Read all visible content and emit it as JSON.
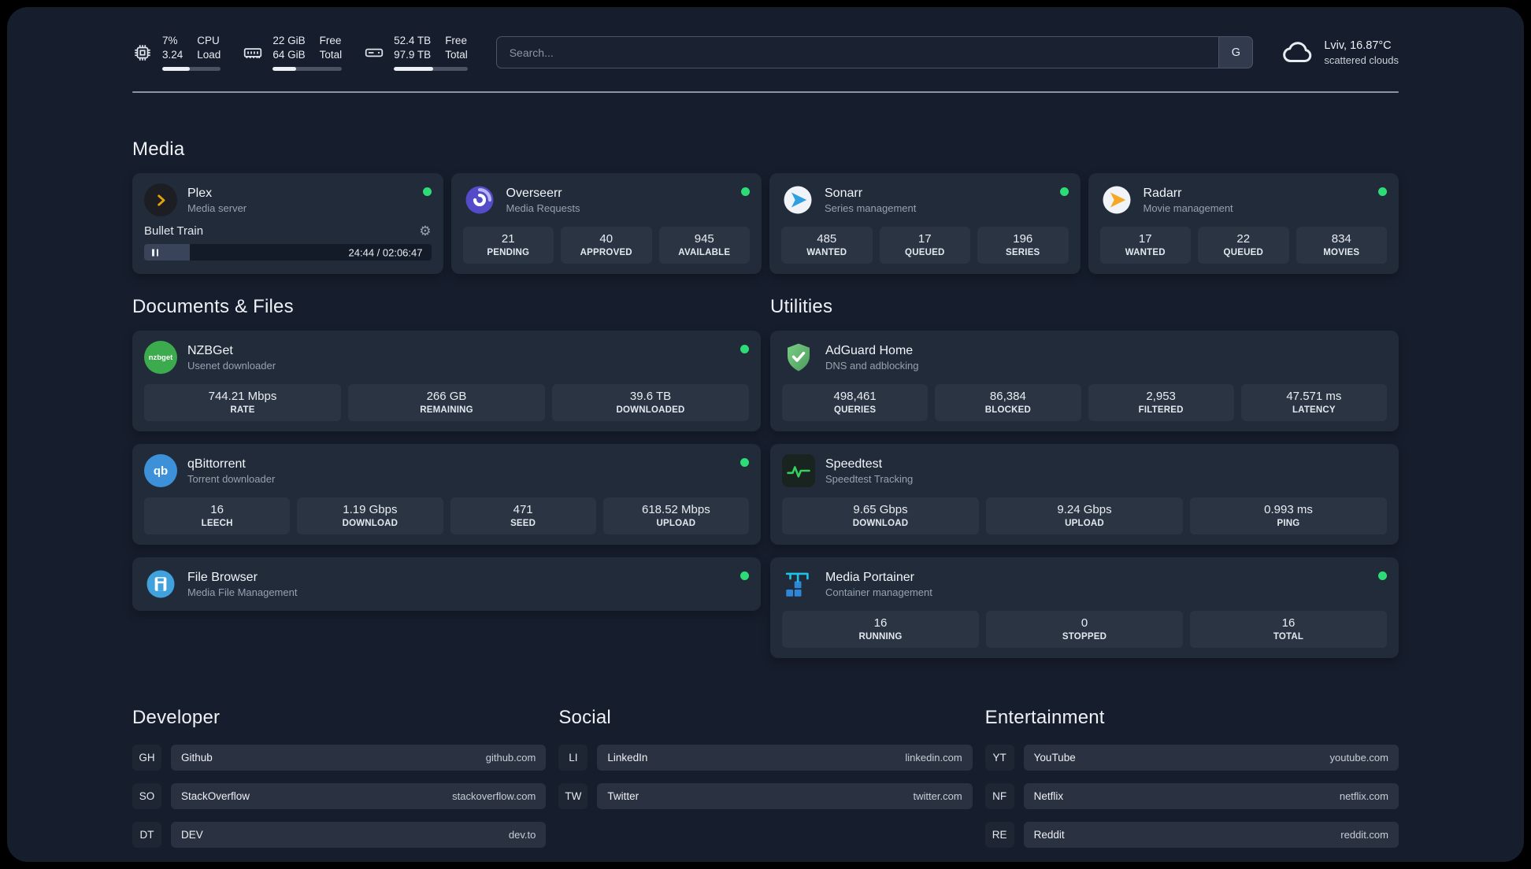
{
  "colors": {
    "status_online": "#2edc77",
    "plex_accent": "#e5a00d",
    "overseerr_accent": "#544bc9",
    "sonarr_accent": "#2f9fe0",
    "radarr_accent": "#f6a723",
    "nzbget_accent": "#3cab4d",
    "qbittorrent_accent": "#3d91d8",
    "filebrowser_accent": "#3fa2dd",
    "adguard_accent": "#68bc71",
    "speedtest_accent": "#35d05f",
    "portainer_accent": "#35b9ea"
  },
  "topbar": {
    "cpu": {
      "line1": "7%",
      "line2": "3.24",
      "label1": "CPU",
      "label2": "Load",
      "percent": 47
    },
    "ram": {
      "line1": "22 GiB",
      "line2": "64 GiB",
      "label1": "Free",
      "label2": "Total",
      "percent": 34
    },
    "disk": {
      "line1": "52.4 TB",
      "line2": "97.9 TB",
      "label1": "Free",
      "label2": "Total",
      "percent": 53
    },
    "search": {
      "placeholder": "Search...",
      "engine_label": "G"
    },
    "weather": {
      "location": "Lviv, 16.87°C",
      "condition": "scattered clouds"
    }
  },
  "sections": {
    "media": "Media",
    "documents": "Documents & Files",
    "utilities": "Utilities",
    "developer": "Developer",
    "social": "Social",
    "entertainment": "Entertainment"
  },
  "apps": {
    "plex": {
      "name": "Plex",
      "subtitle": "Media server",
      "player": {
        "title": "Bullet Train",
        "time": "24:44 / 02:06:47",
        "progress_percent": 16
      }
    },
    "overseerr": {
      "name": "Overseerr",
      "subtitle": "Media Requests",
      "stats": [
        {
          "value": "21",
          "label": "PENDING"
        },
        {
          "value": "40",
          "label": "APPROVED"
        },
        {
          "value": "945",
          "label": "AVAILABLE"
        }
      ]
    },
    "sonarr": {
      "name": "Sonarr",
      "subtitle": "Series management",
      "stats": [
        {
          "value": "485",
          "label": "WANTED"
        },
        {
          "value": "17",
          "label": "QUEUED"
        },
        {
          "value": "196",
          "label": "SERIES"
        }
      ]
    },
    "radarr": {
      "name": "Radarr",
      "subtitle": "Movie management",
      "stats": [
        {
          "value": "17",
          "label": "WANTED"
        },
        {
          "value": "22",
          "label": "QUEUED"
        },
        {
          "value": "834",
          "label": "MOVIES"
        }
      ]
    },
    "nzbget": {
      "name": "NZBGet",
      "subtitle": "Usenet downloader",
      "icon_text": "nzbget",
      "stats": [
        {
          "value": "744.21 Mbps",
          "label": "RATE"
        },
        {
          "value": "266 GB",
          "label": "REMAINING"
        },
        {
          "value": "39.6 TB",
          "label": "DOWNLOADED"
        }
      ]
    },
    "qbittorrent": {
      "name": "qBittorrent",
      "subtitle": "Torrent downloader",
      "icon_text": "qb",
      "stats": [
        {
          "value": "16",
          "label": "LEECH"
        },
        {
          "value": "1.19 Gbps",
          "label": "DOWNLOAD"
        },
        {
          "value": "471",
          "label": "SEED"
        },
        {
          "value": "618.52 Mbps",
          "label": "UPLOAD"
        }
      ]
    },
    "filebrowser": {
      "name": "File Browser",
      "subtitle": "Media File Management"
    },
    "adguard": {
      "name": "AdGuard Home",
      "subtitle": "DNS and adblocking",
      "stats": [
        {
          "value": "498,461",
          "label": "QUERIES"
        },
        {
          "value": "86,384",
          "label": "BLOCKED"
        },
        {
          "value": "2,953",
          "label": "FILTERED"
        },
        {
          "value": "47.571 ms",
          "label": "LATENCY"
        }
      ]
    },
    "speedtest": {
      "name": "Speedtest",
      "subtitle": "Speedtest Tracking",
      "stats": [
        {
          "value": "9.65 Gbps",
          "label": "DOWNLOAD"
        },
        {
          "value": "9.24 Gbps",
          "label": "UPLOAD"
        },
        {
          "value": "0.993 ms",
          "label": "PING"
        }
      ]
    },
    "portainer": {
      "name": "Media Portainer",
      "subtitle": "Container management",
      "stats": [
        {
          "value": "16",
          "label": "RUNNING"
        },
        {
          "value": "0",
          "label": "STOPPED"
        },
        {
          "value": "16",
          "label": "TOTAL"
        }
      ]
    }
  },
  "bookmarks": {
    "developer": [
      {
        "abbr": "GH",
        "name": "Github",
        "url": "github.com"
      },
      {
        "abbr": "SO",
        "name": "StackOverflow",
        "url": "stackoverflow.com"
      },
      {
        "abbr": "DT",
        "name": "DEV",
        "url": "dev.to"
      }
    ],
    "social": [
      {
        "abbr": "LI",
        "name": "LinkedIn",
        "url": "linkedin.com"
      },
      {
        "abbr": "TW",
        "name": "Twitter",
        "url": "twitter.com"
      }
    ],
    "entertainment": [
      {
        "abbr": "YT",
        "name": "YouTube",
        "url": "youtube.com"
      },
      {
        "abbr": "NF",
        "name": "Netflix",
        "url": "netflix.com"
      },
      {
        "abbr": "RE",
        "name": "Reddit",
        "url": "reddit.com"
      }
    ]
  }
}
